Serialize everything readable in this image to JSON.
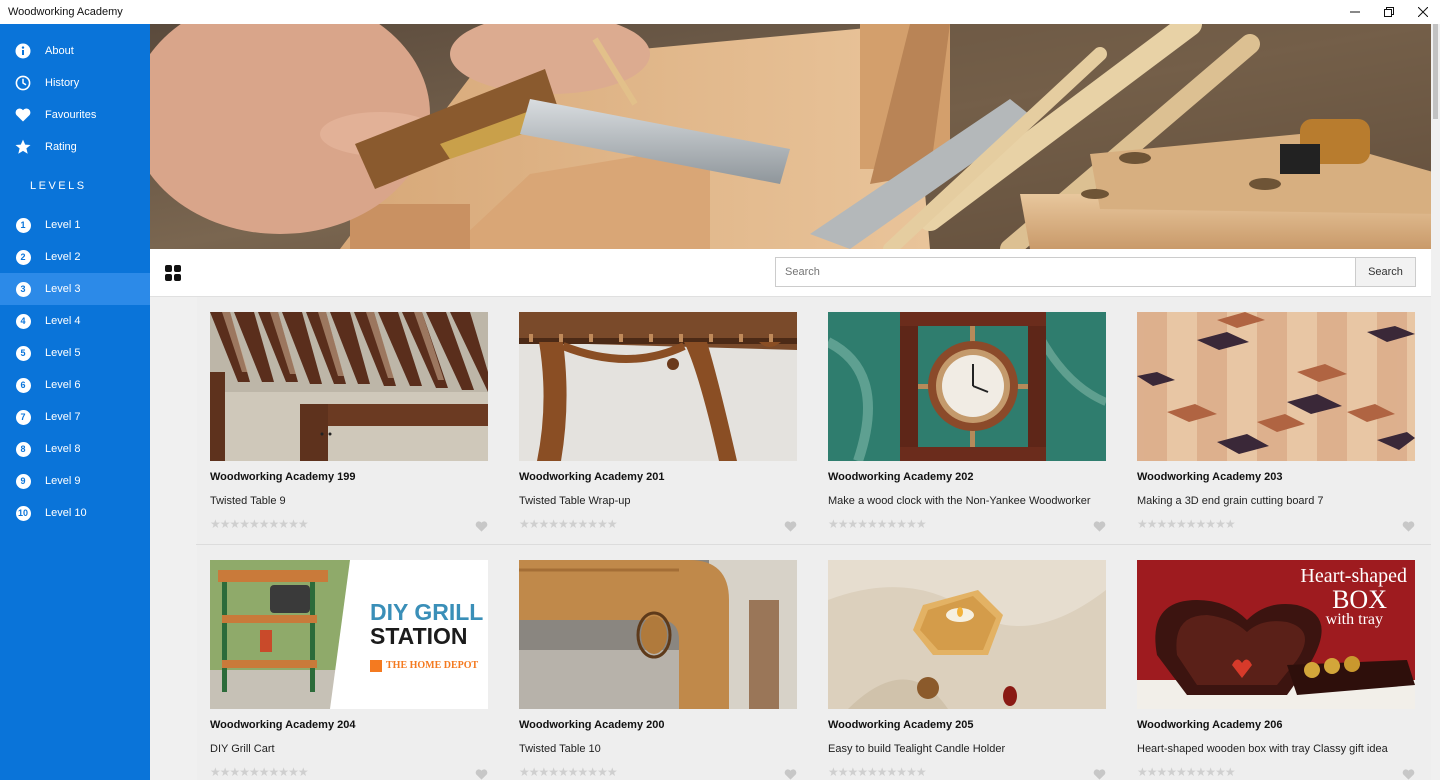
{
  "window": {
    "title": "Woodworking Academy"
  },
  "sidebar": {
    "top_items": [
      {
        "label": "About",
        "icon": "info-icon"
      },
      {
        "label": "History",
        "icon": "clock-icon"
      },
      {
        "label": "Favourites",
        "icon": "heart-icon"
      },
      {
        "label": "Rating",
        "icon": "star-icon"
      }
    ],
    "levels_heading": "LEVELS",
    "levels": [
      {
        "num": "1",
        "label": "Level 1"
      },
      {
        "num": "2",
        "label": "Level 2"
      },
      {
        "num": "3",
        "label": "Level 3",
        "active": true
      },
      {
        "num": "4",
        "label": "Level 4"
      },
      {
        "num": "5",
        "label": "Level 5"
      },
      {
        "num": "6",
        "label": "Level 6"
      },
      {
        "num": "7",
        "label": "Level 7"
      },
      {
        "num": "8",
        "label": "Level 8"
      },
      {
        "num": "9",
        "label": "Level 9"
      },
      {
        "num": "10",
        "label": "Level 10"
      }
    ]
  },
  "search": {
    "placeholder": "Search",
    "button_label": "Search"
  },
  "cards": [
    {
      "title": "Woodworking Academy 199",
      "subtitle": "Twisted Table 9"
    },
    {
      "title": "Woodworking Academy 201",
      "subtitle": "Twisted Table Wrap-up"
    },
    {
      "title": "Woodworking Academy 202",
      "subtitle": "Make a wood clock with the Non-Yankee Woodworker"
    },
    {
      "title": "Woodworking Academy 203",
      "subtitle": "Making a 3D end grain cutting board 7"
    },
    {
      "title": "Woodworking Academy 204",
      "subtitle": "DIY Grill Cart"
    },
    {
      "title": "Woodworking Academy 200",
      "subtitle": "Twisted Table 10"
    },
    {
      "title": "Woodworking Academy 205",
      "subtitle": "Easy to build Tealight Candle Holder"
    },
    {
      "title": "Woodworking Academy 206",
      "subtitle": "Heart-shaped wooden box with tray Classy gift idea"
    }
  ],
  "card_images": {
    "grill": {
      "line1": "DIY GRILL",
      "line2": "STATION",
      "brand": "THE HOME DEPOT"
    },
    "heartbox": {
      "line1": "Heart-shaped",
      "line2": "BOX",
      "line3": "with tray"
    }
  },
  "rating_stars": "★★★★★★★★★★",
  "colors": {
    "sidebar": "#0a74d9",
    "active": "#2c8ae8"
  }
}
